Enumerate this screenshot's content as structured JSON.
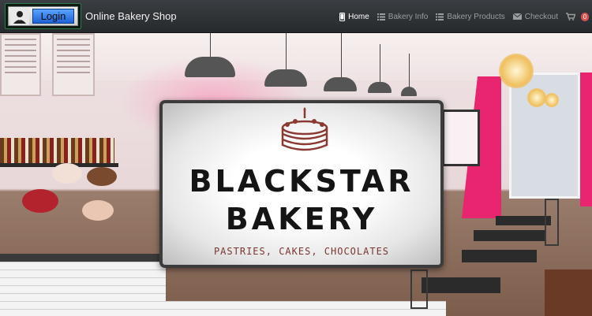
{
  "nav": {
    "login_label": "Login",
    "brand": "Online Bakery Shop",
    "items": [
      {
        "label": "Home",
        "icon": "mobile-icon",
        "active": true
      },
      {
        "label": "Bakery Info",
        "icon": "list-icon",
        "active": false
      },
      {
        "label": "Bakery Products",
        "icon": "list-icon",
        "active": false
      },
      {
        "label": "Checkout",
        "icon": "envelope-icon",
        "active": false
      }
    ],
    "cart": {
      "icon": "cart-icon",
      "count": "0"
    }
  },
  "hero": {
    "sign": {
      "icon": "cake-icon",
      "title_line1": "BLACKSTAR",
      "title_line2": "BAKERY",
      "tagline": "PASTRIES, CAKES, CHOCOLATES"
    }
  },
  "colors": {
    "navbar": "#2f3336",
    "cake_icon": "#8b3a32",
    "tagline": "#7a3630",
    "badge": "#d9534f",
    "accent_pink": "#e8256e"
  }
}
